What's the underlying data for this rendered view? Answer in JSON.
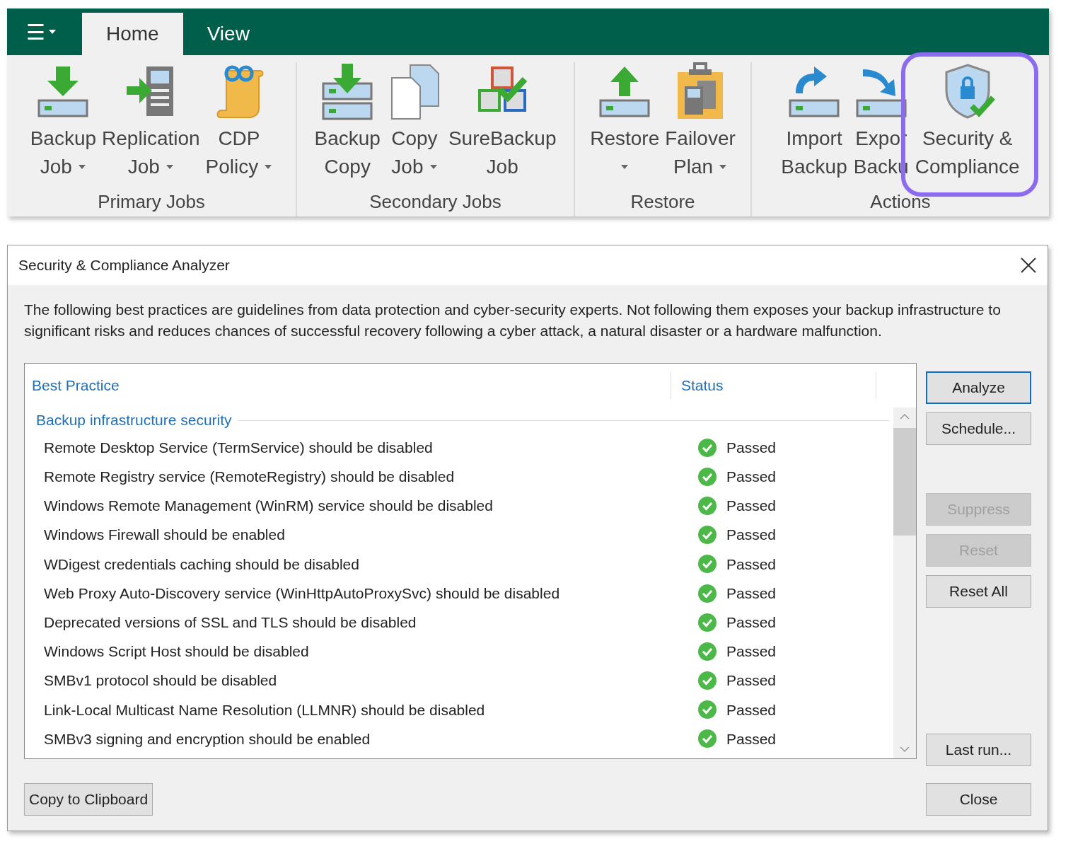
{
  "ribbon": {
    "menu_button": "☰",
    "tabs": [
      {
        "label": "Home",
        "selected": true
      },
      {
        "label": "View",
        "selected": false
      }
    ],
    "groups": [
      {
        "label": "Primary Jobs",
        "items": [
          {
            "lines": [
              "Backup",
              "Job"
            ],
            "dropdown": true,
            "highlighted": false
          },
          {
            "lines": [
              "Replication",
              "Job"
            ],
            "dropdown": true,
            "highlighted": false
          },
          {
            "lines": [
              "CDP",
              "Policy"
            ],
            "dropdown": true,
            "highlighted": false
          }
        ]
      },
      {
        "label": "Secondary Jobs",
        "items": [
          {
            "lines": [
              "Backup",
              "Copy"
            ],
            "dropdown": false,
            "highlighted": false
          },
          {
            "lines": [
              "Copy",
              "Job"
            ],
            "dropdown": true,
            "highlighted": false
          },
          {
            "lines": [
              "SureBackup",
              "Job"
            ],
            "dropdown": false,
            "highlighted": false
          }
        ]
      },
      {
        "label": "Restore",
        "items": [
          {
            "lines": [
              "Restore"
            ],
            "dropdown": true,
            "highlighted": false
          },
          {
            "lines": [
              "Failover",
              "Plan"
            ],
            "dropdown": true,
            "highlighted": false
          }
        ]
      },
      {
        "label": "Actions",
        "items": [
          {
            "lines": [
              "Import",
              "Backup"
            ],
            "dropdown": false,
            "highlighted": false
          },
          {
            "lines": [
              "Expor",
              "Backu"
            ],
            "dropdown": false,
            "highlighted": false
          },
          {
            "lines": [
              "Security &",
              "Compliance"
            ],
            "dropdown": false,
            "highlighted": true
          }
        ]
      }
    ]
  },
  "dialog": {
    "title": "Security & Compliance Analyzer",
    "description": "The following best practices are guidelines from data protection and cyber-security experts. Not following them exposes your backup infrastructure to significant risks and reduces chances of successful recovery following a cyber attack, a natural disaster or a hardware malfunction.",
    "table": {
      "columns": [
        "Best Practice",
        "Status"
      ],
      "group": "Backup infrastructure security",
      "rows": [
        {
          "practice": "Remote Desktop Service (TermService) should be disabled",
          "status": "Passed",
          "kind": "passed"
        },
        {
          "practice": "Remote Registry service (RemoteRegistry) should be disabled",
          "status": "Passed",
          "kind": "passed"
        },
        {
          "practice": "Windows Remote Management (WinRM) service should be disabled",
          "status": "Passed",
          "kind": "passed"
        },
        {
          "practice": "Windows Firewall should be enabled",
          "status": "Passed",
          "kind": "passed"
        },
        {
          "practice": "WDigest credentials caching should be disabled",
          "status": "Passed",
          "kind": "passed"
        },
        {
          "practice": "Web Proxy Auto-Discovery service (WinHttpAutoProxySvc) should be disabled",
          "status": "Passed",
          "kind": "passed"
        },
        {
          "practice": "Deprecated versions of SSL and TLS should be disabled",
          "status": "Passed",
          "kind": "passed"
        },
        {
          "practice": "Windows Script Host should be disabled",
          "status": "Passed",
          "kind": "passed"
        },
        {
          "practice": "SMBv1 protocol should be disabled",
          "status": "Passed",
          "kind": "passed"
        },
        {
          "practice": "Link-Local Multicast Name Resolution (LLMNR) should be disabled",
          "status": "Passed",
          "kind": "passed"
        },
        {
          "practice": "SMBv3 signing and encryption should be enabled",
          "status": "Passed",
          "kind": "passed"
        }
      ]
    },
    "side_buttons": [
      {
        "label": "Analyze",
        "disabled": false,
        "default": true
      },
      {
        "label": "Schedule...",
        "disabled": false,
        "default": false
      },
      {
        "label": "Suppress",
        "disabled": true,
        "default": false
      },
      {
        "label": "Reset",
        "disabled": true,
        "default": false
      },
      {
        "label": "Reset All",
        "disabled": false,
        "default": false
      },
      {
        "label": "Last run...",
        "disabled": false,
        "default": false
      }
    ],
    "copy_button": "Copy to Clipboard",
    "close_button": "Close"
  }
}
